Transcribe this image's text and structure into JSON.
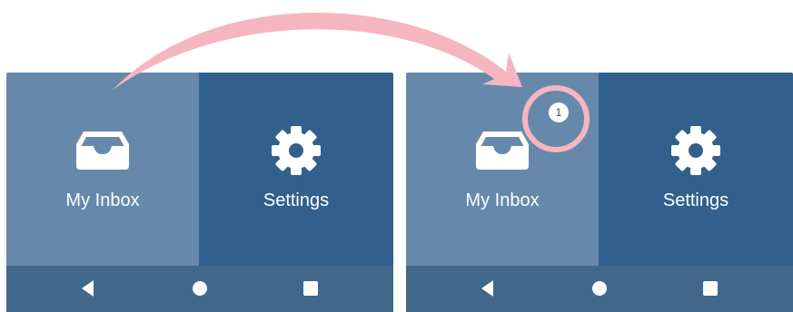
{
  "annotation_color": "#f6b6bf",
  "before": {
    "tiles": [
      {
        "label": "My Inbox",
        "icon": "inbox-icon",
        "color": "#6689ab"
      },
      {
        "label": "Settings",
        "icon": "gear-icon",
        "color": "#31608c"
      }
    ],
    "navbar": {
      "color": "#41678b",
      "buttons": [
        "back-icon",
        "home-icon",
        "recents-icon"
      ]
    }
  },
  "after": {
    "tiles": [
      {
        "label": "My Inbox",
        "icon": "inbox-icon",
        "color": "#6689ab"
      },
      {
        "label": "Settings",
        "icon": "gear-icon",
        "color": "#31608c"
      }
    ],
    "inbox_badge": "1",
    "navbar": {
      "color": "#41678b",
      "buttons": [
        "back-icon",
        "home-icon",
        "recents-icon"
      ]
    }
  }
}
